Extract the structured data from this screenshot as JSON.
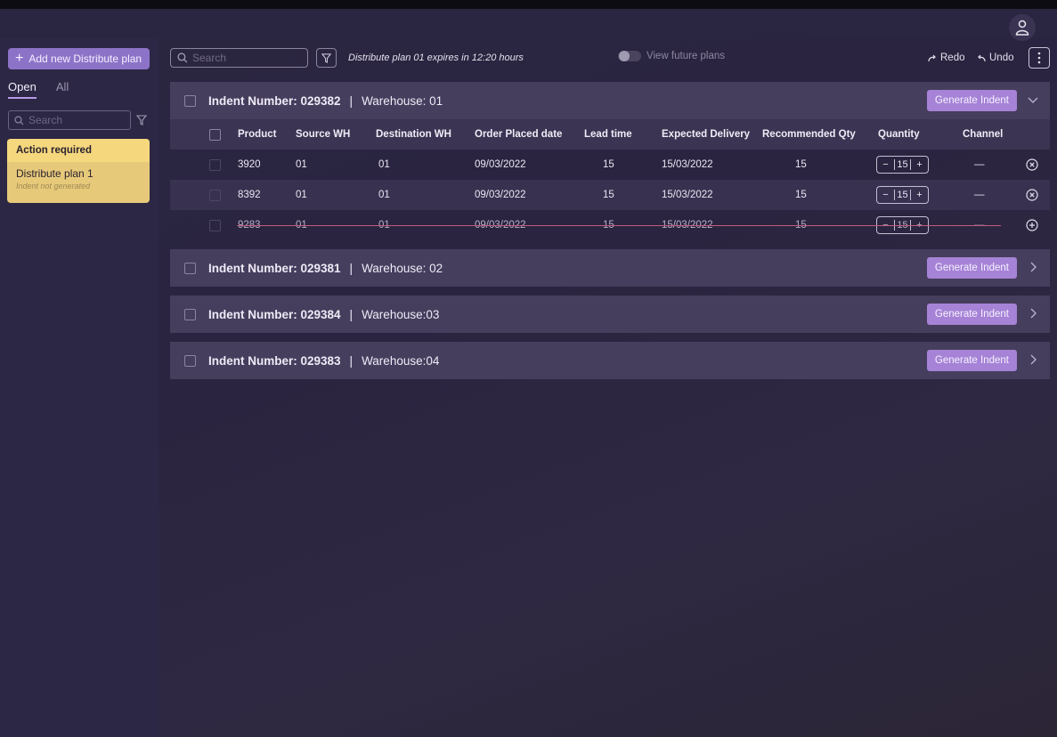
{
  "sidebar": {
    "add_button": "Add new Distribute plan",
    "tabs": [
      "Open",
      "All"
    ],
    "search_placeholder": "Search",
    "card": {
      "heading": "Action required",
      "title": "Distribute plan 1",
      "subtitle": "Indent not generated"
    }
  },
  "toolbar": {
    "search_placeholder": "Search",
    "expiry_text": "Distribute plan 01 expires in 12:20 hours",
    "toggle_label": "View future plans",
    "redo": "Redo",
    "undo": "Undo"
  },
  "generate_label": "Generate Indent",
  "indents": [
    {
      "number": "Indent Number: 029382",
      "warehouse": "Warehouse: 01"
    },
    {
      "number": "Indent Number: 029381",
      "warehouse": "Warehouse: 02"
    },
    {
      "number": "Indent Number: 029384",
      "warehouse": "Warehouse:03"
    },
    {
      "number": "Indent Number: 029383",
      "warehouse": "Warehouse:04"
    }
  ],
  "table": {
    "headers": [
      "Product",
      "Source WH",
      "Destination WH",
      "Order Placed date",
      "Lead time",
      "Expected Delivery",
      "Recommended Qty",
      "Quantity",
      "Channel"
    ],
    "rows": [
      {
        "product": "3920",
        "source": "01",
        "destination": "01",
        "order_date": "09/03/2022",
        "lead": "15",
        "delivery": "15/03/2022",
        "recommended": "15",
        "qty": "15",
        "channel": "—"
      },
      {
        "product": "8392",
        "source": "01",
        "destination": "01",
        "order_date": "09/03/2022",
        "lead": "15",
        "delivery": "15/03/2022",
        "recommended": "15",
        "qty": "15",
        "channel": "—"
      },
      {
        "product": "9283",
        "source": "01",
        "destination": "01",
        "order_date": "09/03/2022",
        "lead": "15",
        "delivery": "15/03/2022",
        "recommended": "15",
        "qty": "15",
        "channel": "—"
      }
    ]
  },
  "icons": [
    "user-icon",
    "plus-icon",
    "search-icon",
    "filter-icon",
    "redo-icon",
    "undo-icon",
    "kebab-icon",
    "chevron-down-icon",
    "chevron-right-icon",
    "remove-circle-icon",
    "add-circle-icon"
  ],
  "colors": {
    "accent": "#a683d6",
    "alert": "#f5d77d",
    "strike": "#c45b7c"
  }
}
